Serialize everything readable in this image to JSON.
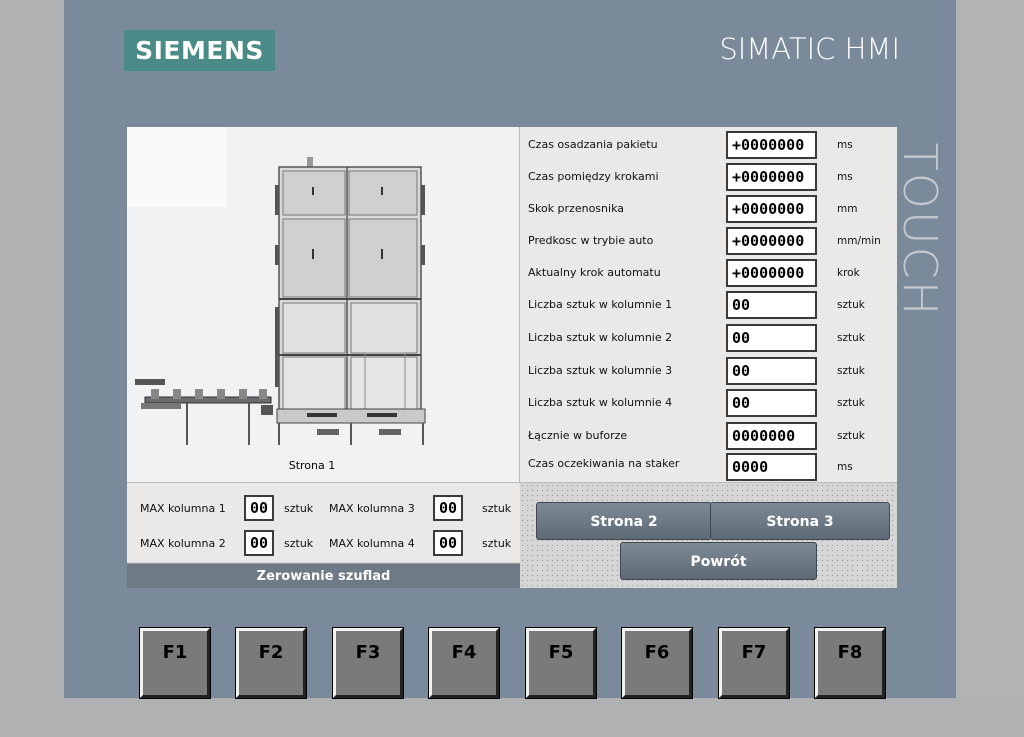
{
  "brand": {
    "logo": "SIEMENS",
    "model": "SIMATIC HMI",
    "touch": "TOUCH"
  },
  "drawing": {
    "caption": "Strona 1"
  },
  "params": [
    {
      "label": "Czas osadzania pakietu",
      "value": "+0000000",
      "unit": "ms"
    },
    {
      "label": "Czas pomiędzy krokami",
      "value": "+0000000",
      "unit": "ms"
    },
    {
      "label": "Skok przenosnika",
      "value": "+0000000",
      "unit": "mm"
    },
    {
      "label": "Predkosc w trybie auto",
      "value": "+0000000",
      "unit": "mm/min"
    },
    {
      "label": "Aktualny krok automatu",
      "value": "+0000000",
      "unit": "krok"
    },
    {
      "label": "Liczba sztuk w kolumnie 1",
      "value": "00",
      "unit": "sztuk"
    },
    {
      "label": "Liczba sztuk w kolumnie 2",
      "value": "00",
      "unit": "sztuk"
    },
    {
      "label": "Liczba sztuk w kolumnie 3",
      "value": "00",
      "unit": "sztuk"
    },
    {
      "label": "Liczba sztuk w kolumnie 4",
      "value": "00",
      "unit": "sztuk"
    },
    {
      "label": "Łącznie w buforze",
      "value": "0000000",
      "unit": "sztuk"
    },
    {
      "label": "Czas oczekiwania na staker",
      "value": "0000",
      "unit": "ms"
    }
  ],
  "max": {
    "k1": {
      "label": "MAX kolumna 1",
      "value": "00",
      "unit": "sztuk"
    },
    "k2": {
      "label": "MAX kolumna 2",
      "value": "00",
      "unit": "sztuk"
    },
    "k3": {
      "label": "MAX kolumna 3",
      "value": "00",
      "unit": "sztuk"
    },
    "k4": {
      "label": "MAX kolumna 4",
      "value": "00",
      "unit": "sztuk"
    }
  },
  "buttons": {
    "zero": "Zerowanie szuflad",
    "page2": "Strona 2",
    "page3": "Strona 3",
    "back": "Powrót"
  },
  "fkeys": [
    "F1",
    "F2",
    "F3",
    "F4",
    "F5",
    "F6",
    "F7",
    "F8"
  ]
}
